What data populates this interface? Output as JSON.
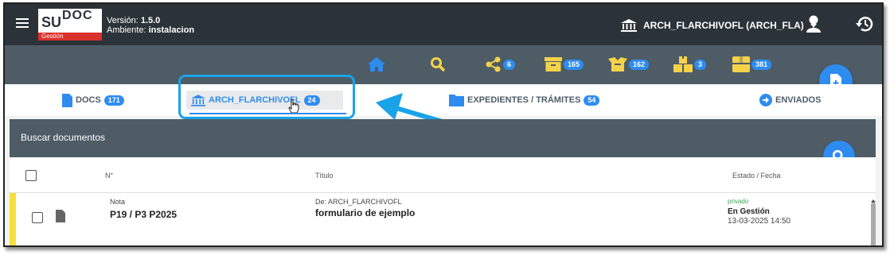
{
  "header": {
    "logo_su": "SU",
    "logo_docs": "DOC",
    "logo_gestion": "Gestión",
    "version_label": "Versión:",
    "version_value": "1.5.0",
    "env_label": "Ambiente:",
    "env_value": "instalacion",
    "archive_selector": "ARCH_FLARCHIVOFL (ARCH_FLA)"
  },
  "nav": {
    "home_icon": "home-icon",
    "search_icon": "search-icon",
    "share_count": "6",
    "inbox_count": "165",
    "boxes_count": "162",
    "pallets_count": "3",
    "package_count": "381",
    "colors": {
      "bar": "#4e5c66",
      "home": "#2e8cf0",
      "icons": "#f5d24a",
      "badge": "#2e8cf0"
    }
  },
  "tabs": [
    {
      "label": "DOCS",
      "count": "171"
    },
    {
      "label": "ARCH_FLARCHIVOFL",
      "count": "24"
    },
    {
      "label": "EXPEDIENTES / TRÁMITES",
      "count": "54"
    },
    {
      "label": "ENVIADOS"
    }
  ],
  "search": {
    "title": "Buscar documentos"
  },
  "table": {
    "col_num": "N°",
    "col_title": "Título",
    "col_status": "Estado / Fecha",
    "rows": [
      {
        "type": "Nota",
        "number": "P19 / P3 P2025",
        "from": "De: ARCH_FLARCHIVOFL",
        "title": "formulario de ejemplo",
        "privacy": "privado",
        "status": "En Gestión",
        "date": "13-03-2025 14:50"
      }
    ]
  }
}
